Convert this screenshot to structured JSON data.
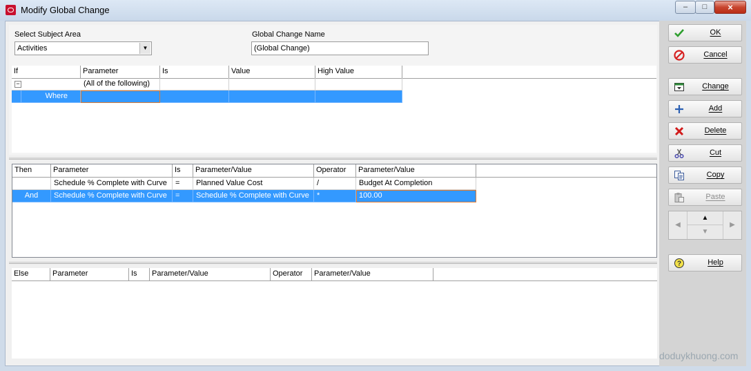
{
  "window": {
    "title": "Modify Global Change",
    "controls": [
      "–",
      "□",
      "×"
    ]
  },
  "subject_area": {
    "label": "Select Subject Area",
    "value": "Activities"
  },
  "change_name": {
    "label": "Global Change Name",
    "value": "(Global Change)"
  },
  "if_grid": {
    "headers": [
      "If",
      "Parameter",
      "Is",
      "Value",
      "High Value"
    ],
    "rows": [
      {
        "cells": [
          "",
          "(All of the following)",
          "",
          "",
          ""
        ],
        "expander": "−"
      },
      {
        "cells": [
          "Where",
          "",
          "",
          "",
          ""
        ]
      }
    ]
  },
  "then_grid": {
    "headers": [
      "Then",
      "Parameter",
      "Is",
      "Parameter/Value",
      "Operator",
      "Parameter/Value"
    ],
    "rows": [
      {
        "cells": [
          "",
          "Schedule % Complete with Curve",
          "=",
          "Planned Value Cost",
          "/",
          "Budget At Completion"
        ]
      },
      {
        "cells": [
          "And",
          "Schedule % Complete with Curve",
          "=",
          "Schedule % Complete with Curve",
          "*",
          "100.00"
        ]
      }
    ]
  },
  "else_grid": {
    "headers": [
      "Else",
      "Parameter",
      "Is",
      "Parameter/Value",
      "Operator",
      "Parameter/Value"
    ]
  },
  "buttons": {
    "ok": "OK",
    "cancel": "Cancel",
    "change": "Change",
    "add": "Add",
    "delete": "Delete",
    "cut": "Cut",
    "copy": "Copy",
    "paste": "Paste",
    "help": "Help"
  },
  "nav": {
    "left": "◀",
    "up": "▲",
    "down": "▼",
    "right": "▶"
  },
  "watermark": "doduykhuong.com",
  "colors": {
    "selection": "#3399ff",
    "edit_outline": "#e07a2f",
    "ok_check": "#2e9e2e",
    "cancel_red": "#d62020"
  }
}
